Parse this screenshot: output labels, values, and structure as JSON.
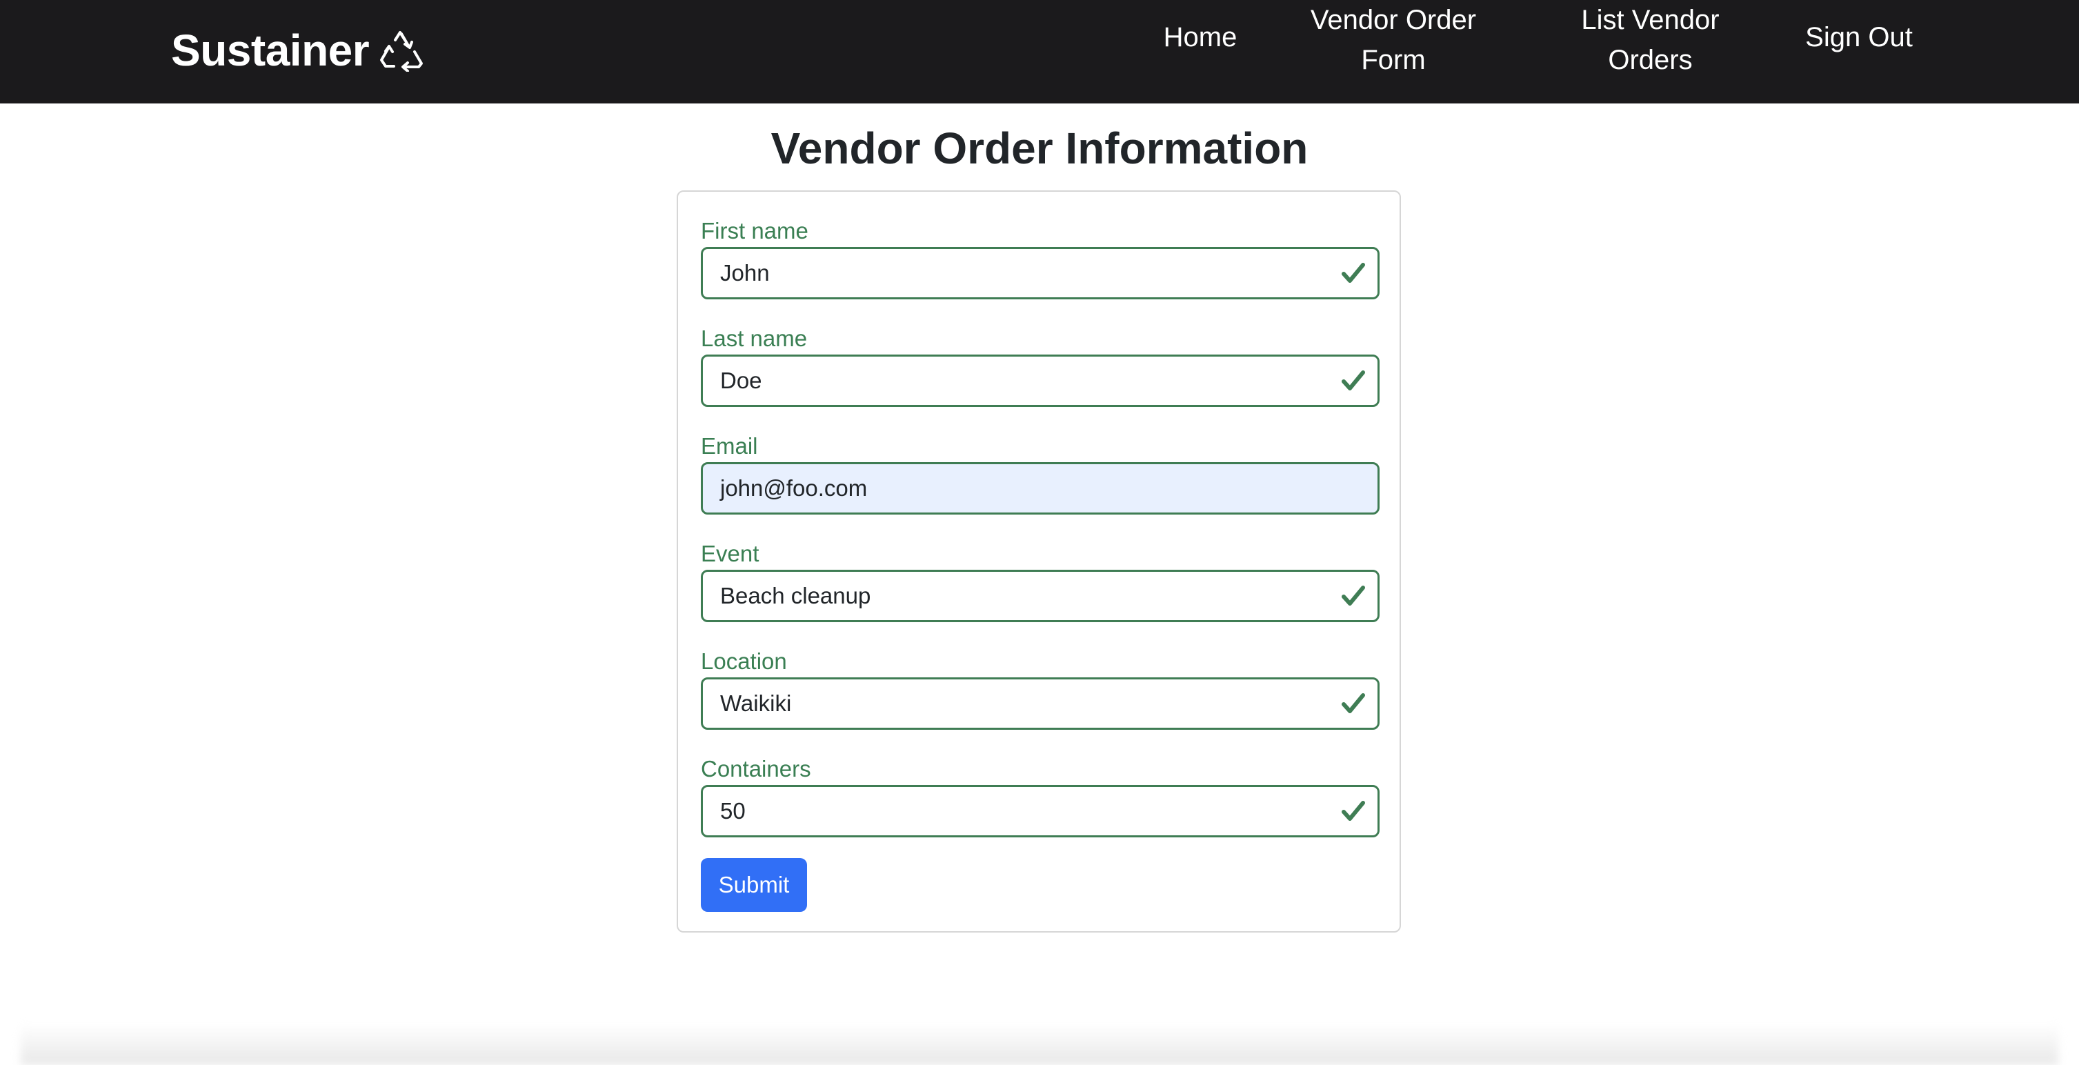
{
  "navbar": {
    "brand": "Sustainer",
    "brand_icon": "recycle-icon",
    "links": [
      {
        "label_line1": "Home",
        "label_line2": ""
      },
      {
        "label_line1": "Vendor Order",
        "label_line2": "Form"
      },
      {
        "label_line1": "List Vendor",
        "label_line2": "Orders"
      },
      {
        "label_line1": "Sign Out",
        "label_line2": ""
      }
    ]
  },
  "page": {
    "title": "Vendor Order Information"
  },
  "form": {
    "fields": [
      {
        "label": "First name",
        "value": "John",
        "valid": true,
        "autofilled": false
      },
      {
        "label": "Last name",
        "value": "Doe",
        "valid": true,
        "autofilled": false
      },
      {
        "label": "Email",
        "value": "john@foo.com",
        "valid": true,
        "autofilled": true
      },
      {
        "label": "Event",
        "value": "Beach cleanup",
        "valid": true,
        "autofilled": false
      },
      {
        "label": "Location",
        "value": "Waikiki",
        "valid": true,
        "autofilled": false
      },
      {
        "label": "Containers",
        "value": "50",
        "valid": true,
        "autofilled": false
      }
    ],
    "submit_label": "Submit"
  },
  "colors": {
    "navbar_bg": "#1b1a1c",
    "valid_green": "#3a7f53",
    "primary_blue": "#316ff6",
    "autofill_bg": "#e8f0fe"
  }
}
